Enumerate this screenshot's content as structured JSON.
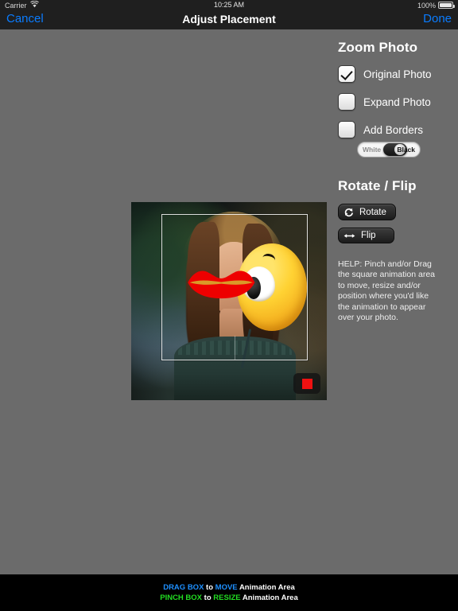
{
  "status_bar": {
    "carrier": "Carrier",
    "wifi_icon": "wifi-icon",
    "time": "10:25 AM",
    "battery_percent": "100%",
    "battery_icon": "battery-icon"
  },
  "nav_bar": {
    "cancel_label": "Cancel",
    "title": "Adjust Placement",
    "done_label": "Done",
    "tint_color": "#0a7cff",
    "background_color": "#1f1f1f"
  },
  "panel": {
    "zoom_section": {
      "title": "Zoom Photo",
      "options": [
        {
          "label": "Original Photo",
          "checked": true
        },
        {
          "label": "Expand Photo",
          "checked": false
        },
        {
          "label": "Add Borders",
          "checked": false
        }
      ],
      "border_toggle": {
        "left_label": "White",
        "right_label": "Black",
        "selected": "Black"
      }
    },
    "rotate_section": {
      "title": "Rotate / Flip",
      "buttons": [
        {
          "label": "Rotate",
          "icon": "rotate-icon"
        },
        {
          "label": "Flip",
          "icon": "flip-horizontal-icon"
        }
      ]
    },
    "help_text": "HELP: Pinch and/or Drag the square animation area to move, resize and/or position where you'd like the animation to appear over your photo."
  },
  "canvas": {
    "photo_description": "Portrait photo of a woman with long brown hair outdoors with bokeh background",
    "overlays": [
      {
        "name": "emoji-face",
        "color": "#ffd233"
      },
      {
        "name": "red-lips",
        "color": "#ee0000"
      }
    ],
    "selection_box": {
      "name": "animation-area-selection"
    },
    "record_button": {
      "name": "stop-record-button",
      "color": "#ee1111"
    }
  },
  "bottom_bar": {
    "line1": {
      "a": "DRAG BOX",
      "b": "to",
      "c": "MOVE",
      "d": "Animation Area"
    },
    "line2": {
      "a": "PINCH BOX",
      "b": "to",
      "c": "RESIZE",
      "d": "Animation Area"
    },
    "accent_blue": "#1e90ff",
    "accent_green": "#22dd22"
  }
}
